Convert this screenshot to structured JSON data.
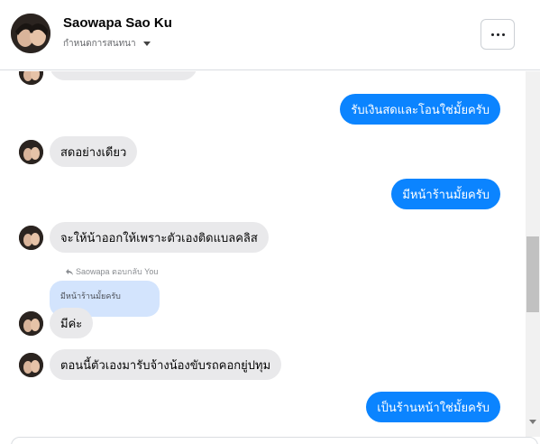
{
  "header": {
    "contact_name": "Saowapa Sao Ku",
    "subtitle": "กำหนดการสนทนา",
    "more_label": "..."
  },
  "messages": {
    "m1": "รับเงินสดและโอนใช่มั้ยครับ",
    "m2": "สดอย่างเดียว",
    "m3": "มีหน้าร้านมั้ยครับ",
    "m4": "จะให้น้าออกให้เพราะตัวเองติดแบลคลิส",
    "reply_label": "Saowapa ตอบกลับ You",
    "reply_quote": "มีหน้าร้านมั้ยครับ",
    "m5": "มีค่ะ",
    "m6": "ตอนนี้ตัวเองมารับจ้างน้องขับรถคอกยู่ปทุม",
    "m7": "เป็นร้านหน้าใช่มั้ยครับ"
  },
  "icons": {
    "avatar": "profile-photo",
    "reply": "reply-arrow-icon",
    "more": "more-dots-icon",
    "dropdown": "caret-down-icon"
  },
  "colors": {
    "outgoing": "#0b84ff",
    "incoming": "#e9e9eb",
    "quote": "#d3e4fd"
  }
}
